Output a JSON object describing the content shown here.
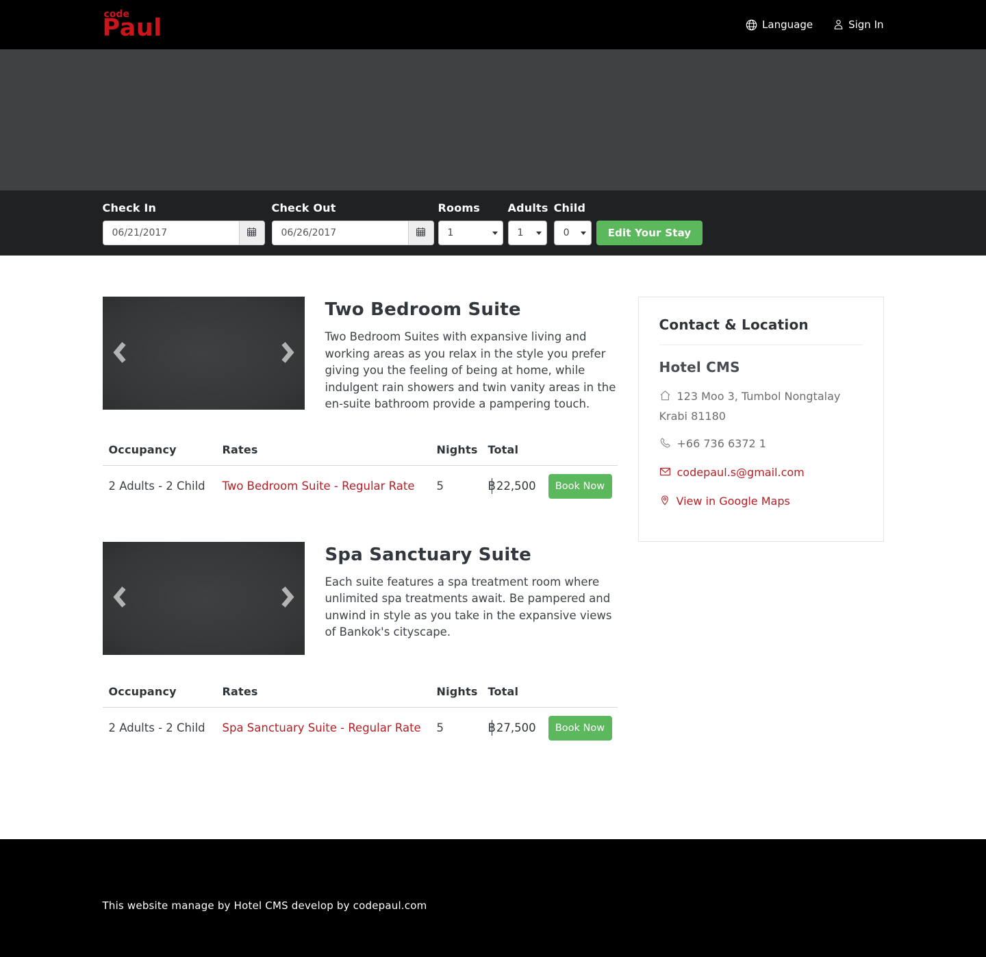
{
  "header": {
    "logo_top": "code",
    "logo_main": "Paul",
    "language_label": "Language",
    "signin_label": "Sign In"
  },
  "booking_bar": {
    "checkin": {
      "label": "Check In",
      "value": "06/21/2017"
    },
    "checkout": {
      "label": "Check Out",
      "value": "06/26/2017"
    },
    "rooms": {
      "label": "Rooms",
      "value": "1"
    },
    "adults": {
      "label": "Adults",
      "value": "1"
    },
    "child": {
      "label": "Child",
      "value": "0"
    },
    "edit_button": "Edit Your Stay"
  },
  "rooms": [
    {
      "title": "Two Bedroom Suite",
      "description": "Two Bedroom Suites with expansive living and working areas as you relax in the style you prefer giving you the feeling of being at home, while indulgent rain showers and twin vanity areas in the en-suite bathroom provide a pampering touch.",
      "table": {
        "headers": [
          "Occupancy",
          "Rates",
          "Nights",
          "Total"
        ],
        "row": {
          "occupancy": "2 Adults - 2 Child",
          "rate": "Two Bedroom Suite - Regular Rate",
          "nights": "5",
          "currency": "฿",
          "amount": "22,500",
          "book_label": "Book Now"
        }
      }
    },
    {
      "title": "Spa Sanctuary Suite",
      "description": "Each suite features a spa treatment room where unlimited spa treatments await. Be pampered and unwind in style as you take in the expansive views of Bankok's cityscape.",
      "table": {
        "headers": [
          "Occupancy",
          "Rates",
          "Nights",
          "Total"
        ],
        "row": {
          "occupancy": "2 Adults - 2 Child",
          "rate": "Spa Sanctuary Suite - Regular Rate",
          "nights": "5",
          "currency": "฿",
          "amount": "27,500",
          "book_label": "Book Now"
        }
      }
    }
  ],
  "sidebar": {
    "title": "Contact & Location",
    "hotel_name": "Hotel CMS",
    "address": "123 Moo 3, Tumbol Nongtalay Krabi 81180",
    "phone": "+66 736 6372 1",
    "email": "codepaul.s@gmail.com",
    "maps_link": "View in Google Maps"
  },
  "footer": {
    "text": "This website manage by Hotel CMS develop by codepaul.com"
  },
  "icons": {
    "globe-icon": "language globe outline",
    "person-icon": "sign-in user outline",
    "calendar-icon": "datepicker calendar grid",
    "chevron-left-icon": "carousel previous arrow",
    "chevron-right-icon": "carousel next arrow",
    "caret-down-icon": "select dropdown caret",
    "home-icon": "address house outline",
    "phone-icon": "telephone handset outline",
    "envelope-icon": "email envelope outline",
    "map-pin-icon": "google maps location pin"
  },
  "colors": {
    "logo_red": "#c9151b",
    "link_red": "#b42025",
    "button_green": "#5cb85c",
    "header_bg": "#000000",
    "hero_bg": "#3f4142",
    "booking_bar_bg": "#1f2122"
  }
}
